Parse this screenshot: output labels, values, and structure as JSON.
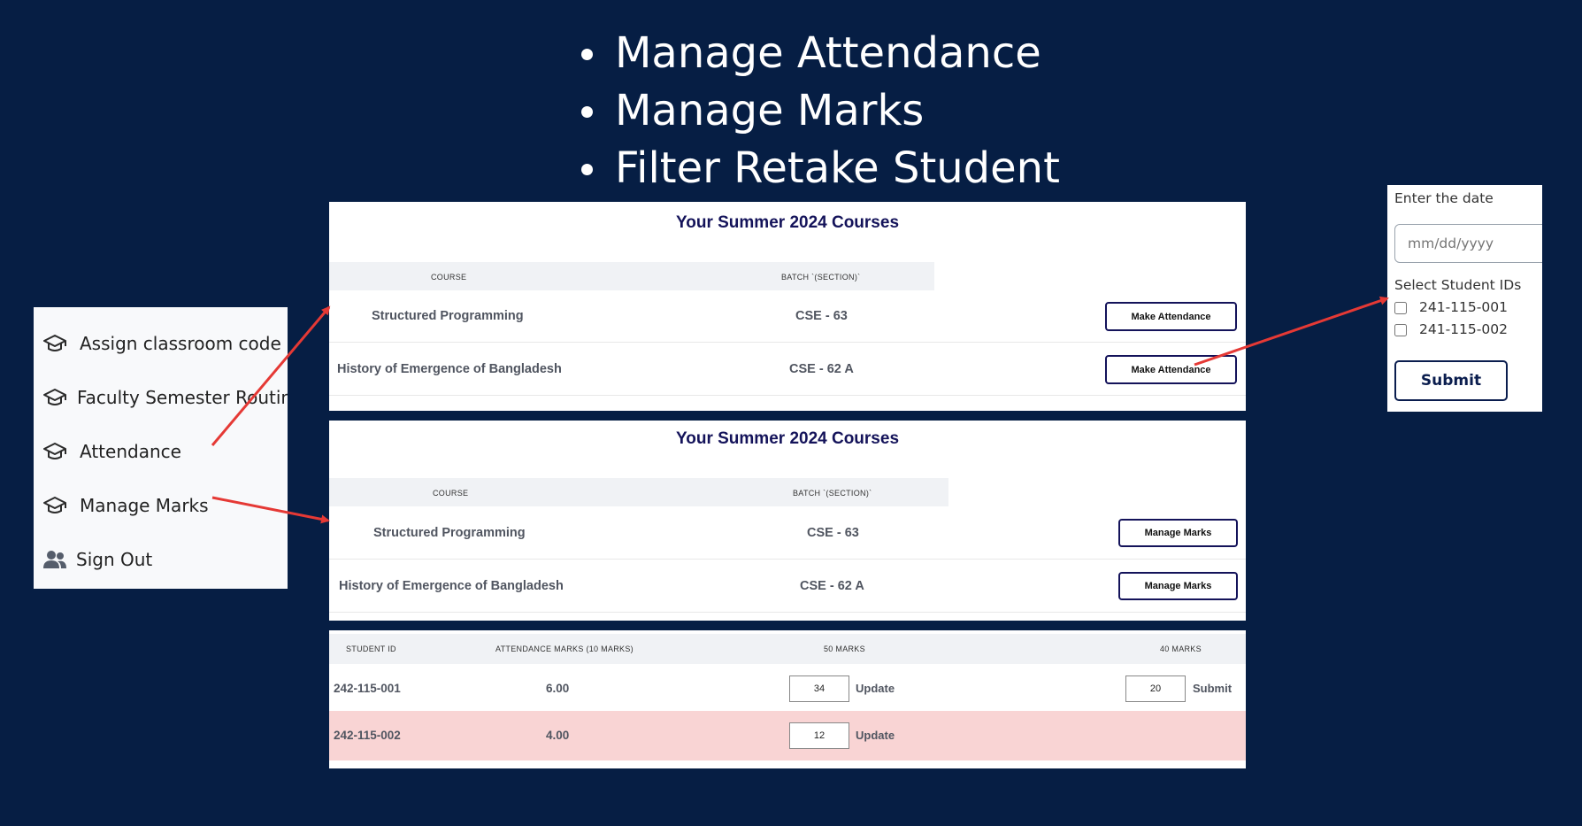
{
  "features": [
    "Manage Attendance",
    "Manage Marks",
    "Filter Retake Student"
  ],
  "sidebar": {
    "items": [
      {
        "label": "Assign classroom code",
        "icon": "graduation-cap-icon"
      },
      {
        "label": "Faculty Semester Routine",
        "icon": "graduation-cap-icon"
      },
      {
        "label": "Attendance",
        "icon": "graduation-cap-icon"
      },
      {
        "label": "Manage Marks",
        "icon": "graduation-cap-icon"
      },
      {
        "label": "Sign Out",
        "icon": "users-icon"
      }
    ]
  },
  "attendance_courses": {
    "title": "Your Summer 2024 Courses",
    "headers": {
      "course": "COURSE",
      "batch": "BATCH `(SECTION)`"
    },
    "rows": [
      {
        "course": "Structured Programming",
        "batch": "CSE - 63",
        "action": "Make Attendance"
      },
      {
        "course": "History of Emergence of Bangladesh",
        "batch": "CSE - 62 A",
        "action": "Make Attendance"
      }
    ]
  },
  "marks_courses": {
    "title": "Your Summer 2024 Courses",
    "headers": {
      "course": "COURSE",
      "batch": "BATCH `(SECTION)`"
    },
    "rows": [
      {
        "course": "Structured Programming",
        "batch": "CSE - 63",
        "action": "Manage Marks"
      },
      {
        "course": "History of Emergence of Bangladesh",
        "batch": "CSE - 62 A",
        "action": "Manage Marks"
      }
    ]
  },
  "marks_table": {
    "headers": {
      "student_id": "STUDENT ID",
      "attendance": "ATTENDANCE MARKS (10 MARKS)",
      "fifty": "50 MARKS",
      "forty": "40 MARKS"
    },
    "rows": [
      {
        "student_id": "242-115-001",
        "attendance": "6.00",
        "fifty_value": "34",
        "fifty_action": "Update",
        "forty_value": "20",
        "forty_action": "Submit",
        "highlight": false
      },
      {
        "student_id": "242-115-002",
        "attendance": "4.00",
        "fifty_value": "12",
        "fifty_action": "Update",
        "highlight": true
      }
    ],
    "highlight_color": "#f9d4d4"
  },
  "date_form": {
    "date_label": "Enter the date",
    "date_placeholder": "mm/dd/yyyy",
    "students_label": "Select Student IDs",
    "students": [
      {
        "id": "241-115-001",
        "checked": false
      },
      {
        "id": "241-115-002",
        "checked": false
      }
    ],
    "submit_label": "Submit"
  },
  "colors": {
    "background": "#061e44",
    "title_navy": "#14135a",
    "arrow_red": "#e53935"
  }
}
